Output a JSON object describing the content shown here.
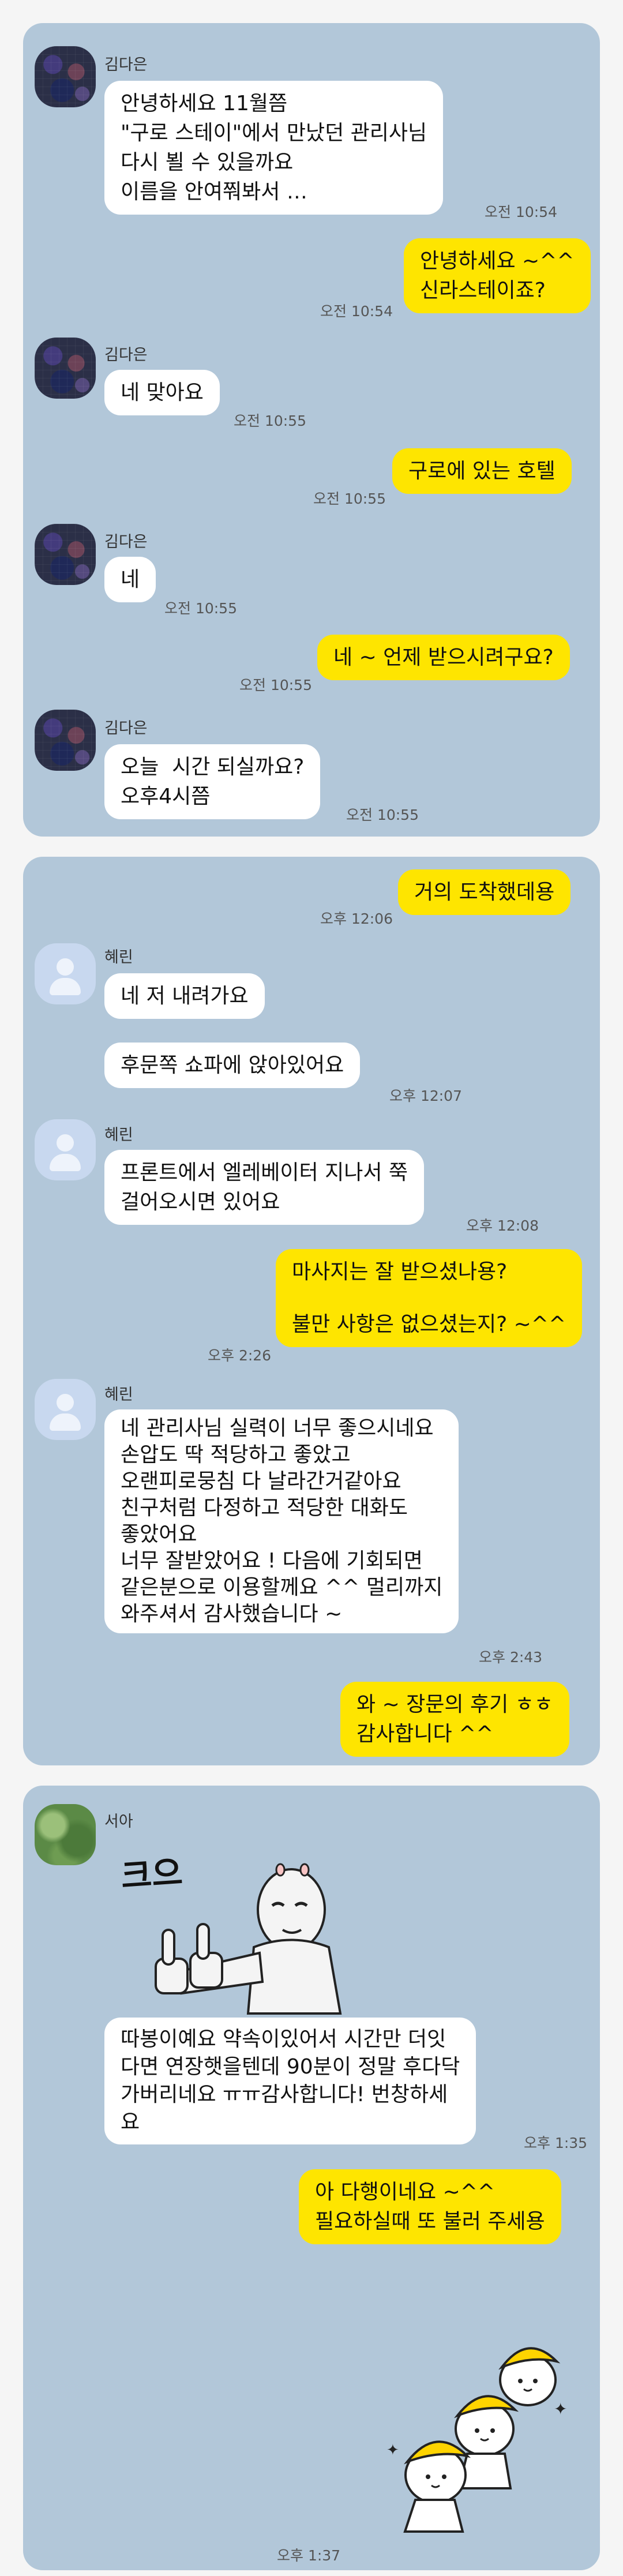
{
  "panel1": {
    "sender": "김다은",
    "messages": {
      "m1": [
        "안녕하세요 11월쯤",
        "\"구로 스테이\"에서 만났던 관리사님",
        "다시 뵐 수 있을까요",
        "이름을 안여쭤봐서 …"
      ],
      "m1_time": "오전 10:54",
      "m2": [
        "안녕하세요 ~^^",
        "신라스테이죠?"
      ],
      "m2_time": "오전 10:54",
      "m3": "네 맞아요",
      "m3_time": "오전 10:55",
      "m4": "구로에 있는 호텔",
      "m4_time": "오전 10:55",
      "m5": "네",
      "m5_time": "오전 10:55",
      "m6": "네 ~ 언제 받으시려구요?",
      "m6_time": "오전 10:55",
      "m7": [
        "오늘  시간 되실까요?",
        "오후4시쯤"
      ],
      "m7_time": "오전 10:55"
    }
  },
  "panel2": {
    "sender": "혜린",
    "messages": {
      "m1": "거의 도착했데용",
      "m1_time": "오후 12:06",
      "m2": "네 저 내려가요",
      "m3": "후문쪽 쇼파에 앉아있어요",
      "m3_time": "오후 12:07",
      "m4": [
        "프론트에서 엘레베이터 지나서 쭉",
        "걸어오시면 있어요"
      ],
      "m4_time": "오후 12:08",
      "m5a": "마사지는 잘 받으셨나용?",
      "m5b": "불만 사항은 없으셨는지? ~^^",
      "m5_time": "오후 2:26",
      "m6": [
        "네 관리사님 실력이 너무 좋으시네요",
        "손압도 딱 적당하고 좋았고",
        "오랜피로뭉침 다 날라간거같아요",
        "친구처럼 다정하고 적당한 대화도",
        "좋았어요",
        "너무 잘받았어요 ! 다음에 기회되면",
        "같은분으로 이용할께요 ^^ 멀리까지",
        "와주셔서 감사했습니다 ~"
      ],
      "m6_time": "오후 2:43",
      "m7": [
        "와 ~ 장문의 후기 ㅎㅎ",
        "감사합니다 ^^"
      ]
    }
  },
  "panel3": {
    "sender": "서아",
    "sticker_text": "크으",
    "messages": {
      "m1": [
        "따봉이예요 약속이있어서 시간만 더잇",
        "다면 연장햇을텐데 90분이 정말 후다닥",
        "가버리네요 ㅠㅠ감사합니다! 번창하세",
        "요"
      ],
      "m1_time": "오후 1:35",
      "m2": [
        "아 다행이네요 ~^^",
        "필요하실때 또 불러 주세용"
      ],
      "m2_time": "오후 1:37"
    }
  },
  "colors": {
    "panel_bg": "#b2c7d9",
    "outgoing": "#fee500",
    "incoming": "#ffffff"
  }
}
